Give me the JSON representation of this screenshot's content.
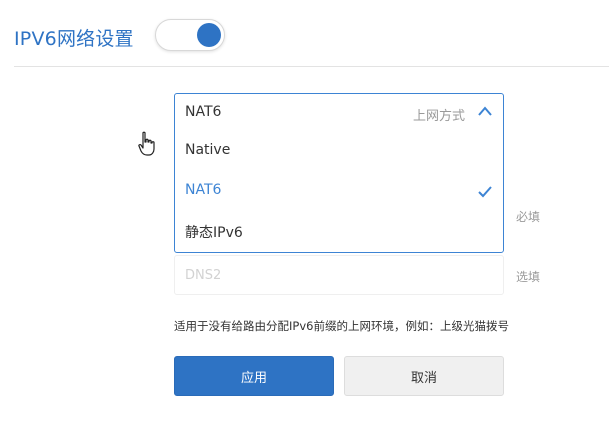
{
  "header": {
    "title": "IPV6网络设置",
    "toggle_on": true
  },
  "connection_type": {
    "selected": "NAT6",
    "hint": "上网方式",
    "expanded": true,
    "options": [
      {
        "label": "Native",
        "selected": false
      },
      {
        "label": "NAT6",
        "selected": true
      },
      {
        "label": "静态IPv6",
        "selected": false
      }
    ]
  },
  "dns1": {
    "tag": "必填"
  },
  "dns2": {
    "placeholder": "DNS2",
    "tag": "选填"
  },
  "note": "适用于没有给路由分配IPv6前缀的上网环境，例如：上级光猫拨号",
  "buttons": {
    "apply": "应用",
    "cancel": "取消"
  },
  "colors": {
    "accent": "#2e73c4",
    "border_focus": "#3d84d4"
  },
  "icons": {
    "dropdown": "chevron-up-icon",
    "selected": "check-icon",
    "pointer": "hand-pointer-icon"
  }
}
